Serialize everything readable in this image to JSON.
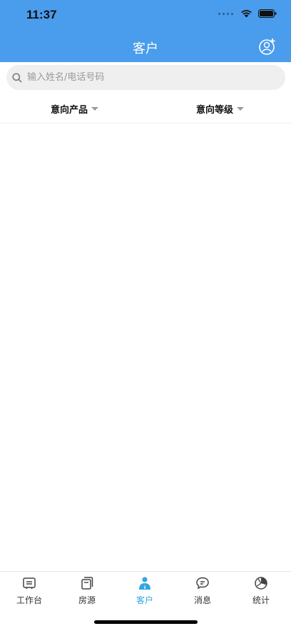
{
  "status": {
    "time": "11:37"
  },
  "header": {
    "title": "客户"
  },
  "search": {
    "placeholder": "输入姓名/电话号码"
  },
  "filters": [
    {
      "label": "意向产品"
    },
    {
      "label": "意向等级"
    }
  ],
  "tabs": [
    {
      "label": "工作台",
      "icon": "workbench-icon"
    },
    {
      "label": "房源",
      "icon": "listings-icon"
    },
    {
      "label": "客户",
      "icon": "customer-icon",
      "active": true
    },
    {
      "label": "消息",
      "icon": "message-icon"
    },
    {
      "label": "统计",
      "icon": "statistics-icon"
    }
  ],
  "colors": {
    "header": "#4a9cec",
    "active_tab": "#33a6e0"
  }
}
